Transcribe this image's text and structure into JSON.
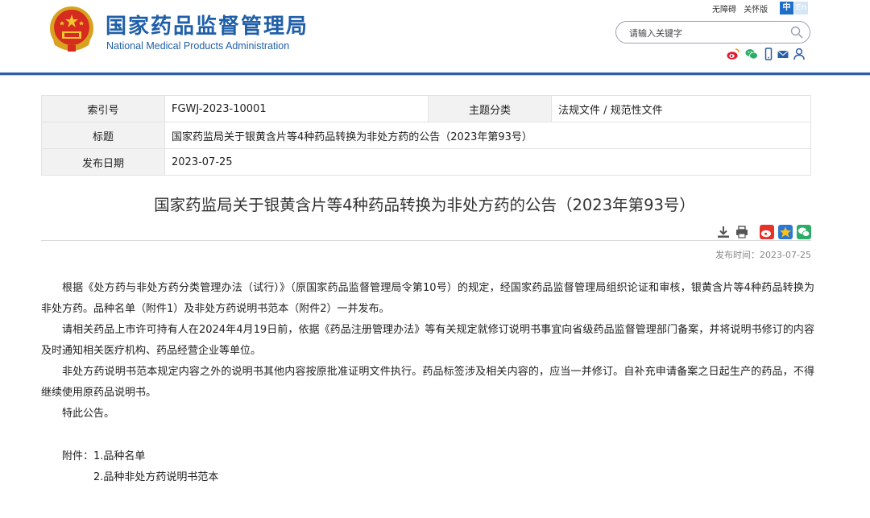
{
  "header": {
    "brand_cn": "国家药品监督管理局",
    "brand_en": "National Medical Products Administration",
    "top_links": [
      "无障碍",
      "关怀版"
    ],
    "lang_zh": "中",
    "lang_en": "En",
    "search_placeholder": "请输入关键字",
    "social_icons": [
      "weibo-icon",
      "wechat-icon",
      "mobile-icon",
      "mail-icon",
      "user-icon"
    ]
  },
  "info": {
    "index_label": "索引号",
    "index_value": "FGWJ-2023-10001",
    "topic_label": "主题分类",
    "topic_value": "法规文件 / 规范性文件",
    "title_label": "标题",
    "title_value": "国家药监局关于银黄含片等4种药品转换为非处方药的公告（2023年第93号）",
    "date_label": "发布日期",
    "date_value": "2023-07-25"
  },
  "article": {
    "title": "国家药监局关于银黄含片等4种药品转换为非处方药的公告（2023年第93号）",
    "publish_time": "发布时间：2023-07-25",
    "paragraphs": [
      "根据《处方药与非处方药分类管理办法（试行）》（原国家药品监督管理局令第10号）的规定，经国家药品监督管理局组织论证和审核，银黄含片等4种药品转换为非处方药。品种名单（附件1）及非处方药说明书范本（附件2）一并发布。",
      "请相关药品上市许可持有人在2024年4月19日前，依据《药品注册管理办法》等有关规定就修订说明书事宜向省级药品监督管理部门备案，并将说明书修订的内容及时通知相关医疗机构、药品经营企业等单位。",
      "非处方药说明书范本规定内容之外的说明书其他内容按原批准证明文件执行。药品标签涉及相关内容的，应当一并修订。自补充申请备案之日起生产的药品，不得继续使用原药品说明书。",
      "特此公告。"
    ],
    "attachment_1": "附件：1.品种名单",
    "attachment_2": "2.品种非处方药说明书范本"
  },
  "colors": {
    "brand_blue": "#1f5fa8",
    "header_rule": "#2860a8",
    "label_bg": "#f2f2f2"
  }
}
